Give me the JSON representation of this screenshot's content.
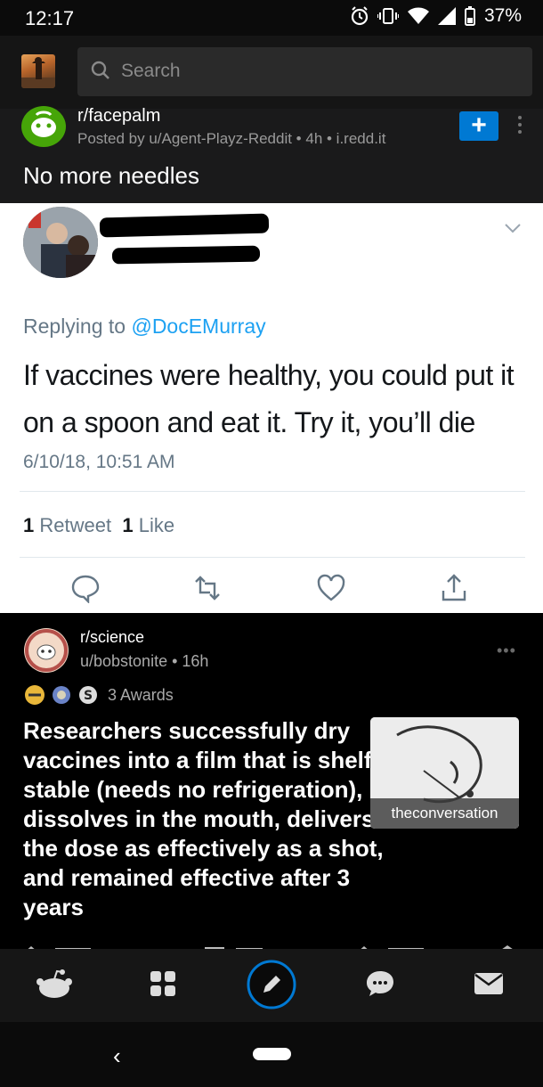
{
  "status_bar": {
    "time": "12:17",
    "battery": "37%"
  },
  "header": {
    "search_placeholder": "Search"
  },
  "post": {
    "subreddit": "r/facepalm",
    "meta": "Posted by u/Agent-Playz-Reddit • 4h • i.redd.it",
    "join_label": "+",
    "title": "No more needles"
  },
  "tweet": {
    "replying_prefix": "Replying to ",
    "replying_handle": "@DocEMurray",
    "text": "If vaccines were healthy, you could put it on a spoon and eat it. Try it, you’ll die",
    "date": "6/10/18, 10:51 AM",
    "retweet_count": "1",
    "retweet_label": "Retweet",
    "like_count": "1",
    "like_label": "Like"
  },
  "crosspost": {
    "subreddit": "r/science",
    "user_time": "u/bobstonite • 16h",
    "awards": "3 Awards",
    "more": "•••",
    "title": "Researchers successfully dry vaccines into a film that is shelf-stable (needs no refrigeration), dissolves in the mouth, delivers the dose as effectively as a shot, and remained effective after 3 years",
    "thumb_label": "theconversation"
  },
  "system_nav": {
    "back": "‹"
  },
  "colors": {
    "reddit_blue": "#0079d3",
    "twitter_blue": "#1da1f2",
    "facepalm_green": "#46a508"
  },
  "icons": [
    "wifi-icon",
    "signal-icon",
    "alarm-icon",
    "vibrate-icon",
    "battery-icon",
    "search-icon",
    "more-vertical-icon",
    "chevron-down-icon",
    "reply-icon",
    "retweet-icon",
    "like-icon",
    "share-icon",
    "snoo-icon",
    "grid-icon",
    "pencil-icon",
    "chat-icon",
    "mail-icon"
  ]
}
